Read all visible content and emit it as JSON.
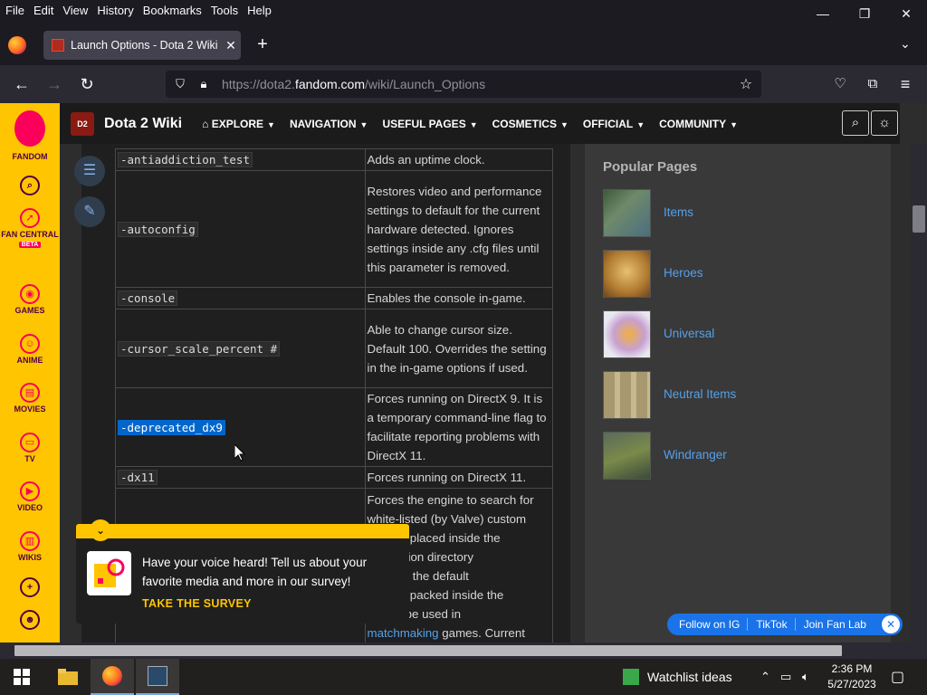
{
  "menu": [
    "File",
    "Edit",
    "View",
    "History",
    "Bookmarks",
    "Tools",
    "Help"
  ],
  "window_controls": {
    "minimize": "—",
    "restore": "❐",
    "close": "✕"
  },
  "tab": {
    "title": "Launch Options - Dota 2 Wiki",
    "close": "✕",
    "new": "+"
  },
  "url": {
    "prefix": "https://dota2.",
    "domain": "fandom.com",
    "path": "/wiki/Launch_Options"
  },
  "fandom_rail": [
    {
      "label": "FANDOM",
      "icon": "fandom-flame-icon"
    },
    {
      "label": "",
      "icon": "search-icon"
    },
    {
      "label": "FAN CENTRAL",
      "icon": "rocket-icon",
      "badge": "BETA"
    },
    {
      "label": "GAMES",
      "icon": "controller-icon"
    },
    {
      "label": "ANIME",
      "icon": "anime-face-icon"
    },
    {
      "label": "MOVIES",
      "icon": "clapper-icon"
    },
    {
      "label": "TV",
      "icon": "tv-icon"
    },
    {
      "label": "VIDEO",
      "icon": "play-icon"
    },
    {
      "label": "WIKIS",
      "icon": "book-icon"
    },
    {
      "label": "",
      "icon": "plus-icon"
    },
    {
      "label": "",
      "icon": "user-icon"
    }
  ],
  "wiki": {
    "name": "Dota 2 Wiki",
    "nav": [
      "EXPLORE",
      "NAVIGATION",
      "USEFUL PAGES",
      "COSMETICS",
      "OFFICIAL",
      "COMMUNITY"
    ]
  },
  "table": [
    {
      "cmd": "-antiaddiction_test",
      "desc": "Adds an uptime clock."
    },
    {
      "cmd": "-autoconfig",
      "desc": "Restores video and performance settings to default for the current hardware detected. Ignores settings inside any .cfg files until this parameter is removed."
    },
    {
      "cmd": "-console",
      "desc": "Enables the console in-game."
    },
    {
      "cmd": "-cursor_scale_percent #",
      "desc": "Able to change cursor size. Default 100. Overrides the setting in the in-game options if used."
    },
    {
      "cmd": "-deprecated_dx9",
      "desc": "Forces running on DirectX 9. It is a temporary command-line flag to facilitate reporting problems with DirectX 11."
    },
    {
      "cmd": "-dx11",
      "desc": "Forces running on DirectX 11."
    },
    {
      "cmd": "",
      "desc_a": "Forces the engine to search for white-listed (by Valve) custom",
      "desc_b": "content placed inside the",
      "desc_c": "installation directory",
      "desc_d": "of using the default",
      "desc_e": "content packed inside the",
      "desc_f": "s. Can be used in",
      "desc_link": "matchmaking",
      "desc_g": " games. Current"
    }
  ],
  "popular": {
    "title": "Popular Pages",
    "items": [
      "Items",
      "Heroes",
      "Universal",
      "Neutral Items",
      "Windranger"
    ]
  },
  "banner": {
    "text": "Have your voice heard! Tell us about your favorite media and more in our survey!",
    "cta": "TAKE THE SURVEY"
  },
  "social": [
    "Follow on IG",
    "TikTok",
    "Join Fan Lab"
  ],
  "taskbar": {
    "notification": "Watchlist ideas",
    "time": "2:36 PM",
    "date": "5/27/2023"
  }
}
